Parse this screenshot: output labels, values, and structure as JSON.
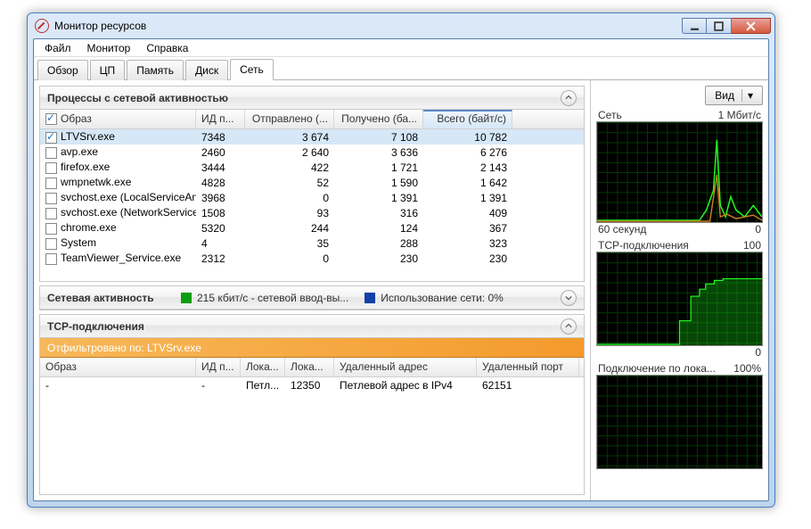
{
  "window": {
    "title": "Монитор ресурсов"
  },
  "menu": {
    "file": "Файл",
    "monitor": "Монитор",
    "help": "Справка"
  },
  "tabs": {
    "overview": "Обзор",
    "cpu": "ЦП",
    "memory": "Память",
    "disk": "Диск",
    "network": "Сеть"
  },
  "panels": {
    "processes": {
      "title": "Процессы с сетевой активностью",
      "cols": {
        "image": "Образ",
        "pid": "ИД п...",
        "sent": "Отправлено (...",
        "recv": "Получено (ба...",
        "total": "Всего (байт/с)"
      },
      "rows": [
        {
          "img": "LTVSrv.exe",
          "pid": "7348",
          "sent": "3 674",
          "recv": "7 108",
          "total": "10 782",
          "checked": true
        },
        {
          "img": "avp.exe",
          "pid": "2460",
          "sent": "2 640",
          "recv": "3 636",
          "total": "6 276"
        },
        {
          "img": "firefox.exe",
          "pid": "3444",
          "sent": "422",
          "recv": "1 721",
          "total": "2 143"
        },
        {
          "img": "wmpnetwk.exe",
          "pid": "4828",
          "sent": "52",
          "recv": "1 590",
          "total": "1 642"
        },
        {
          "img": "svchost.exe (LocalServiceAn...",
          "pid": "3968",
          "sent": "0",
          "recv": "1 391",
          "total": "1 391"
        },
        {
          "img": "svchost.exe (NetworkService)",
          "pid": "1508",
          "sent": "93",
          "recv": "316",
          "total": "409"
        },
        {
          "img": "chrome.exe",
          "pid": "5320",
          "sent": "244",
          "recv": "124",
          "total": "367"
        },
        {
          "img": "System",
          "pid": "4",
          "sent": "35",
          "recv": "288",
          "total": "323"
        },
        {
          "img": "TeamViewer_Service.exe",
          "pid": "2312",
          "sent": "0",
          "recv": "230",
          "total": "230"
        }
      ]
    },
    "activity": {
      "title": "Сетевая активность",
      "io_label": "215 кбит/с - сетевой ввод-вы...",
      "usage_label": "Использование сети: 0%"
    },
    "tcp": {
      "title": "TCP-подключения",
      "filter": "Отфильтровано по: LTVSrv.exe",
      "cols": {
        "image": "Образ",
        "pid": "ИД п...",
        "local": "Лока...",
        "lport": "Лока...",
        "remote": "Удаленный адрес",
        "rport": "Удаленный порт"
      },
      "rows": [
        {
          "img": "-",
          "pid": "-",
          "local": "Петл...",
          "lport": "12350",
          "remote": "Петлевой адрес в IPv4",
          "rport": "62151"
        }
      ]
    }
  },
  "right": {
    "view_btn": "Вид",
    "graphs": [
      {
        "title": "Сеть",
        "max": "1 Мбит/с",
        "footer_left": "60 секунд",
        "footer_right": "0"
      },
      {
        "title": "TCP-подключения",
        "max": "100",
        "footer_left": "",
        "footer_right": "0"
      },
      {
        "title": "Подключение по лока...",
        "max": "100%",
        "footer_left": "",
        "footer_right": ""
      }
    ]
  }
}
